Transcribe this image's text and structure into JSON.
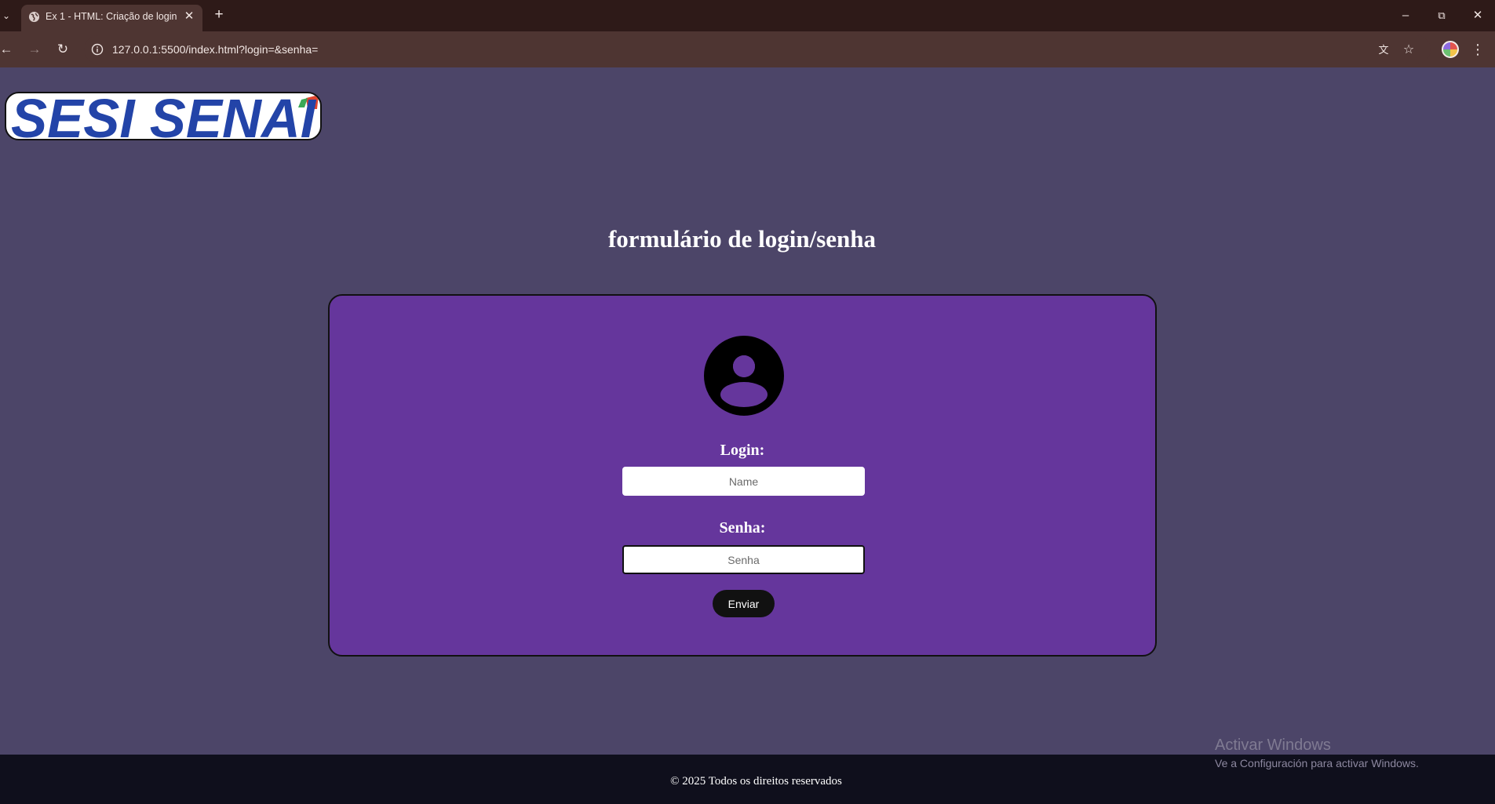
{
  "browser": {
    "tab_title": "Ex 1 - HTML: Criação de login",
    "url": "127.0.0.1:5500/index.html?login=&senha=",
    "icons": {
      "tab_list": "chevron-down-icon",
      "favicon": "globe-icon",
      "close_tab": "close-icon",
      "new_tab": "plus-icon",
      "minimize": "minimize-icon",
      "restore": "restore-icon",
      "close_window": "close-icon",
      "back": "back-arrow-icon",
      "forward": "forward-arrow-icon",
      "reload": "reload-icon",
      "site_info": "info-icon",
      "translate": "translate-icon",
      "bookmark": "star-icon",
      "profile": "profile-avatar-icon",
      "menu": "kebab-menu-icon"
    }
  },
  "page": {
    "logo_text": "SESI SENAI",
    "title": "formulário de login/senha",
    "form": {
      "avatar_icon": "user-circle-icon",
      "login_label": "Login:",
      "login_placeholder": "Name",
      "senha_label": "Senha:",
      "senha_placeholder": "Senha",
      "submit_label": "Enviar"
    },
    "footer": "© 2025 Todos os direitos reservados"
  },
  "os_overlay": {
    "watermark_title": "Activar Windows",
    "watermark_subtitle": "Ve a Configuración para activar Windows."
  },
  "colors": {
    "page_background": "#4c4568",
    "card_background": "#65369c",
    "footer_background": "#0f0f1c",
    "button_background": "#111111",
    "logo_blue": "#2344a8"
  }
}
